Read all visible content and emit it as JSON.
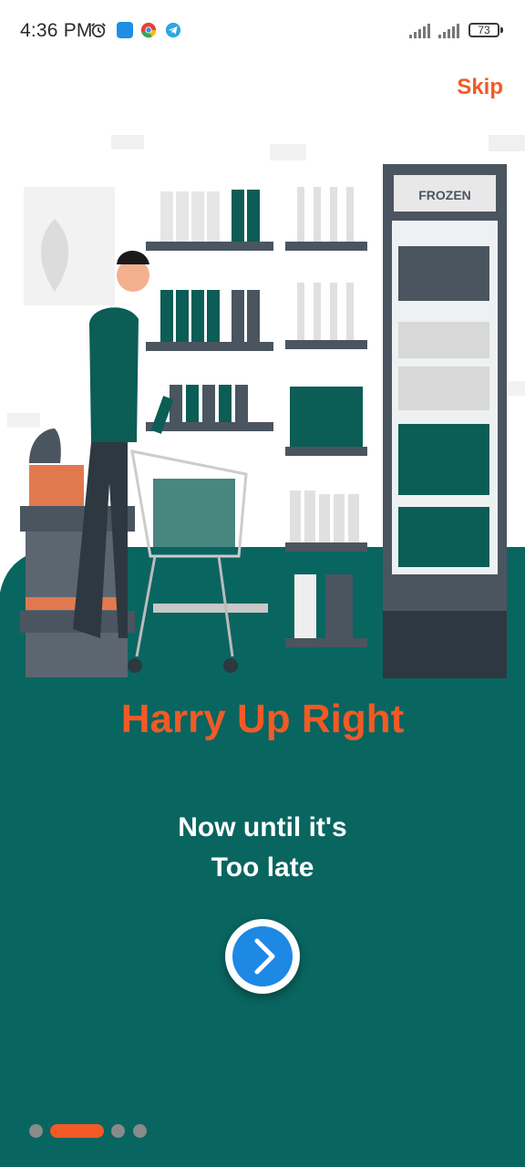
{
  "status_bar": {
    "time": "4:36 PM",
    "battery_level": "73",
    "icons": [
      "alarm-icon",
      "notification-app-icon",
      "chrome-icon",
      "telegram-icon",
      "signal-icon",
      "signal-icon",
      "battery-icon"
    ]
  },
  "onboarding": {
    "skip_label": "Skip",
    "freezer_label": "FROZEN",
    "headline": "Harry Up Right",
    "subtitle_line1": "Now until it's",
    "subtitle_line2": "Too late",
    "next_icon": "chevron-right-icon",
    "page_count": 4,
    "current_page": 2
  },
  "colors": {
    "accent": "#f15a25",
    "panel": "#096560",
    "button": "#1e88e5",
    "dot_inactive": "#8a8a8a"
  }
}
